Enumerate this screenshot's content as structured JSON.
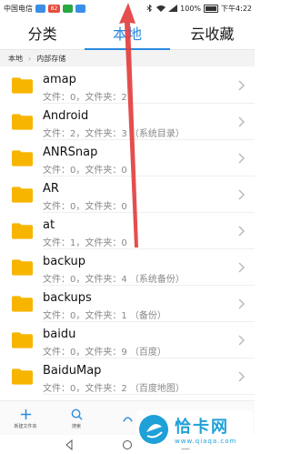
{
  "status_bar": {
    "carrier": "中国电信",
    "battery": "100%",
    "time": "下午4:22",
    "badge_text": "82",
    "colors": {
      "blue": "#3a8ee6",
      "red": "#e74c3c",
      "green": "#29a745"
    }
  },
  "tabs": [
    {
      "label": "分类",
      "active": false
    },
    {
      "label": "本地",
      "active": true
    },
    {
      "label": "云收藏",
      "active": false
    }
  ],
  "breadcrumb": [
    "本地",
    "内部存储"
  ],
  "folders": [
    {
      "name": "amap",
      "meta": "文件：0，文件夹：2"
    },
    {
      "name": "Android",
      "meta": "文件：2，文件夹：3 （系统目录）"
    },
    {
      "name": "ANRSnap",
      "meta": "文件：0，文件夹：0"
    },
    {
      "name": "AR",
      "meta": "文件：0，文件夹：0"
    },
    {
      "name": "at",
      "meta": "文件：1，文件夹：0"
    },
    {
      "name": "backup",
      "meta": "文件：0，文件夹：4 （系统备份）"
    },
    {
      "name": "backups",
      "meta": "文件：0，文件夹：1 （备份）"
    },
    {
      "name": "baidu",
      "meta": "文件：0，文件夹：9 （百度）"
    },
    {
      "name": "BaiduMap",
      "meta": "文件：0，文件夹：2 （百度地图）"
    }
  ],
  "bottom_bar": [
    {
      "icon": "plus-icon",
      "label": "新建文件夹"
    },
    {
      "icon": "search-icon",
      "label": "搜索"
    },
    {
      "icon": "sort-icon",
      "label": ""
    },
    {
      "icon": "list-icon",
      "label": ""
    },
    {
      "icon": "more-icon",
      "label": ""
    }
  ],
  "watermark": {
    "brand": "恰卡网",
    "url": "www.qiaqa.com"
  },
  "accent_color": "#2a8ae0",
  "folder_color": "#f7b500",
  "arrow_color": "#e23b3b"
}
